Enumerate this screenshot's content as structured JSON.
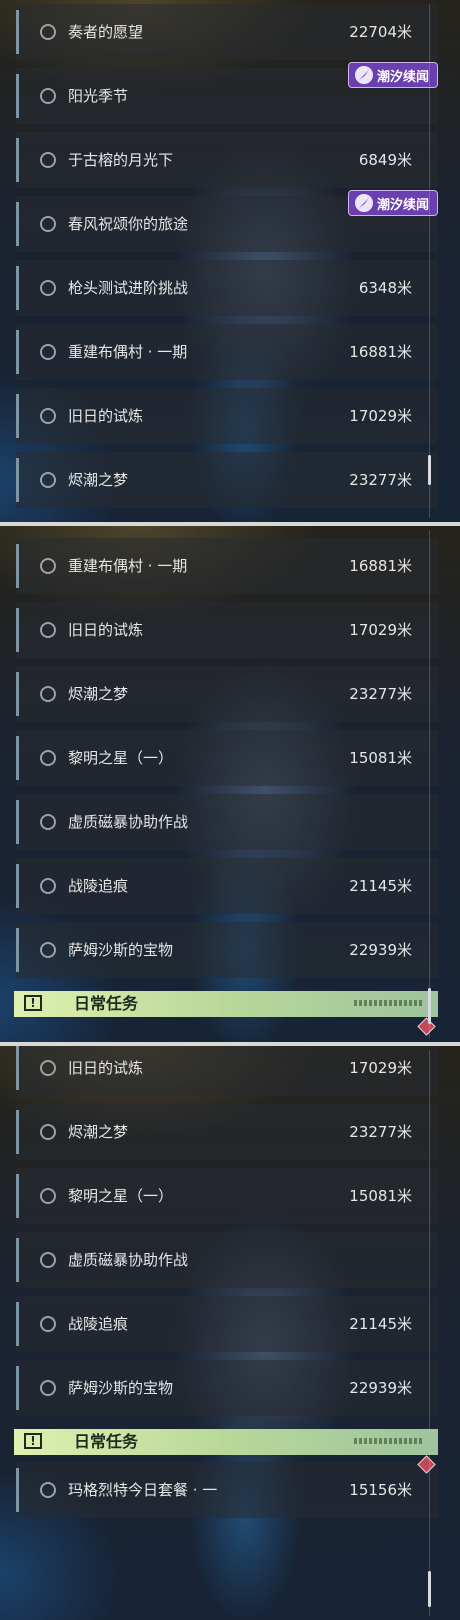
{
  "panel1": {
    "rows": [
      {
        "name": "奏者的愿望",
        "distance": "22704米"
      },
      {
        "name": "阳光季节",
        "distance": ""
      },
      {
        "name": "于古榕的月光下",
        "distance": "6849米"
      },
      {
        "name": "春风祝颂你的旅途",
        "distance": ""
      },
      {
        "name": "枪头测试进阶挑战",
        "distance": "6348米"
      },
      {
        "name": "重建布偶村 · 一期",
        "distance": "16881米"
      },
      {
        "name": "旧日的试炼",
        "distance": "17029米"
      },
      {
        "name": "烬潮之梦",
        "distance": "23277米"
      }
    ],
    "badges": [
      {
        "label": "潮汐续闻",
        "icon": "tide-event-icon"
      },
      {
        "label": "潮汐续闻",
        "icon": "tide-event-icon"
      }
    ]
  },
  "panel2": {
    "rows": [
      {
        "name": "重建布偶村 · 一期",
        "distance": "16881米"
      },
      {
        "name": "旧日的试炼",
        "distance": "17029米"
      },
      {
        "name": "烬潮之梦",
        "distance": "23277米"
      },
      {
        "name": "黎明之星（一）",
        "distance": "15081米"
      },
      {
        "name": "虚质磁暴协助作战",
        "distance": ""
      },
      {
        "name": "战陵追痕",
        "distance": "21145米"
      },
      {
        "name": "萨姆沙斯的宝物",
        "distance": "22939米"
      }
    ],
    "daily_label": "日常任务"
  },
  "panel3": {
    "rows": [
      {
        "name": "旧日的试炼",
        "distance": "17029米"
      },
      {
        "name": "烬潮之梦",
        "distance": "23277米"
      },
      {
        "name": "黎明之星（一）",
        "distance": "15081米"
      },
      {
        "name": "虚质磁暴协助作战",
        "distance": ""
      },
      {
        "name": "战陵追痕",
        "distance": "21145米"
      },
      {
        "name": "萨姆沙斯的宝物",
        "distance": "22939米"
      }
    ],
    "daily_label": "日常任务",
    "daily_rows": [
      {
        "name": "玛格烈特今日套餐 · 一",
        "distance": "15156米"
      }
    ]
  },
  "colors": {
    "badge": "#6a3fb0",
    "daily_header": "#b8d89a",
    "row_accent": "#7d95a5",
    "marker": "#c0485a"
  }
}
